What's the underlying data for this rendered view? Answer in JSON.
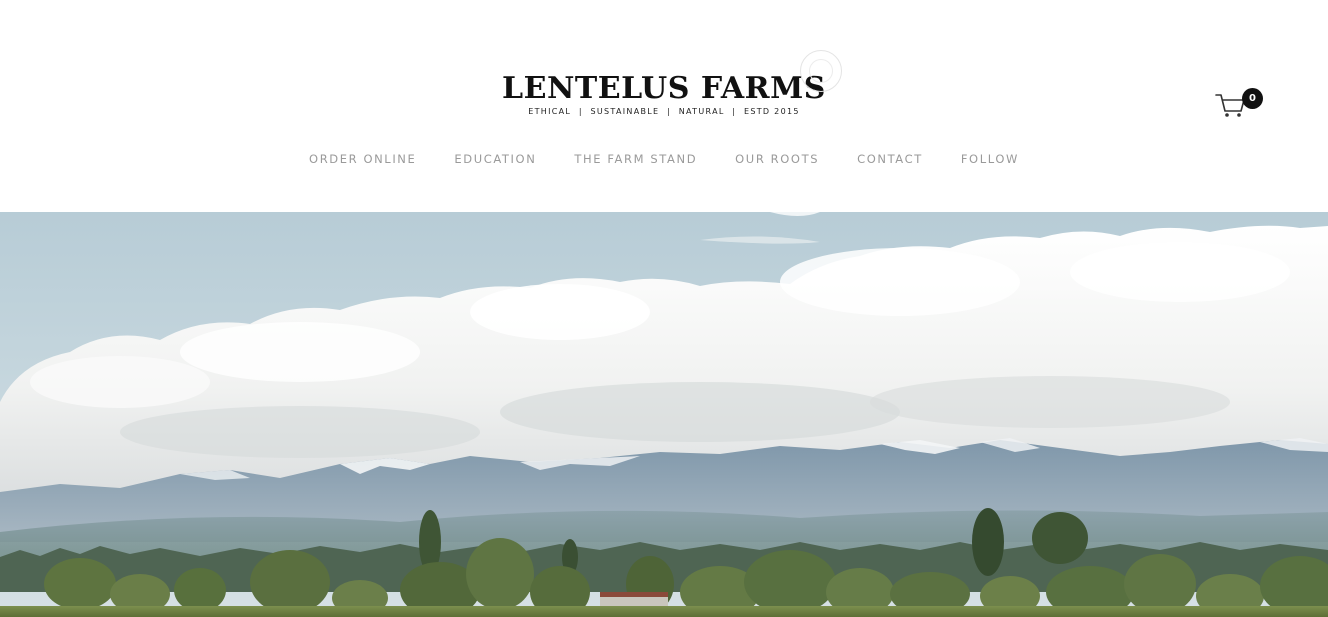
{
  "brand": {
    "name": "LENTELUS FARMS",
    "tagline": "ETHICAL  |  SUSTAINABLE  |  NATURAL  |  ESTD 2015"
  },
  "nav": {
    "items": [
      {
        "label": "ORDER ONLINE"
      },
      {
        "label": "EDUCATION"
      },
      {
        "label": "THE FARM STAND"
      },
      {
        "label": "OUR ROOTS"
      },
      {
        "label": "CONTACT"
      },
      {
        "label": "FOLLOW"
      }
    ]
  },
  "cart": {
    "count": "0",
    "icon": "cart-icon"
  },
  "hero": {
    "image": "landscape-mountains-clouds-trees"
  },
  "colors": {
    "nav_text": "#9a9a9a",
    "logo_text": "#111111",
    "badge_bg": "#111111",
    "sky": "#bcd1da"
  }
}
